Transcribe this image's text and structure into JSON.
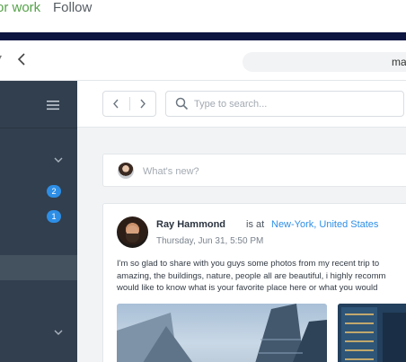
{
  "page_header": {
    "partial_link": "or work",
    "follow_label": "Follow"
  },
  "browser": {
    "url_partial": "ma"
  },
  "sidebar": {
    "badges": [
      "2",
      "1"
    ],
    "accent_color": "#2d8ee6"
  },
  "toolbar": {
    "search_placeholder": "Type to search..."
  },
  "compose": {
    "placeholder": "What's new?"
  },
  "post": {
    "author": "Ray Hammond",
    "is_at": "is at",
    "location": "New-York, United States",
    "timestamp": "Thursday, Jun 31, 5:50 PM",
    "body_lines": [
      "I'm so glad to share with you guys some photos from my recent trip to",
      "amazing, the buildings, nature, people all are beautiful, i highly recomm",
      "would like to know what is your favorite place here or what you would"
    ]
  },
  "icons": [
    "caret-down-icon",
    "back-arrow-icon",
    "hamburger-menu-icon",
    "chevron-down-icon",
    "chevron-left-icon",
    "chevron-right-icon",
    "search-icon"
  ]
}
